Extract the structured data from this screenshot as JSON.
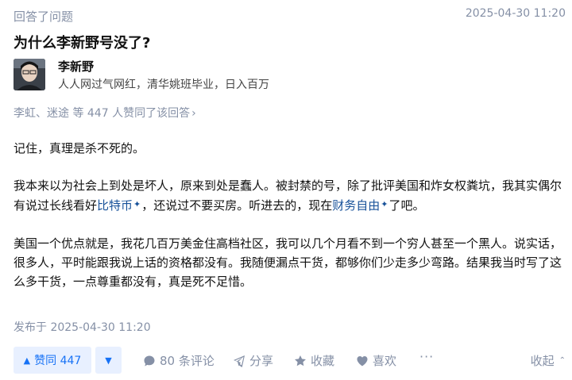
{
  "header": {
    "kicker": "回答了问题",
    "timestamp": "2025-04-30 11:20"
  },
  "question": {
    "title": "为什么李新野号没了?"
  },
  "author": {
    "name": "李新野",
    "bio": "人人网过气网红，清华姚班毕业，日入百万"
  },
  "voters": {
    "text": "李虹、迷途 等 447 人赞同了该回答",
    "chevron": "›"
  },
  "content": {
    "p1": "记住，真理是杀不死的。",
    "p2_a": "我本来以为社会上到处是坏人，原来到处是蠢人。被封禁的号，除了批评美国和炸女权粪坑，我其实偶尔有说过长线看好",
    "p2_link1": "比特币",
    "p2_b": "，还说过不要买房。听进去的，现在",
    "p2_link2": "财务自由",
    "p2_c": "了吧。",
    "p3": "美国一个优点就是，我花几百万美金住高档社区，我可以几个月看不到一个穷人甚至一个黑人。说实话，很多人，平时能跟我说上话的资格都没有。我随便漏点干货，都够你们少走多少弯路。结果我当时写了这么多干货，一点尊重都没有，真是死不足惜。",
    "spark_glyph": "✦"
  },
  "footer": {
    "published": "发布于 2025-04-30 11:20"
  },
  "actions": {
    "upvote": "赞同 447",
    "upvote_glyph": "▲",
    "downvote_glyph": "▼",
    "comment": "80 条评论",
    "share": "分享",
    "favorite": "收藏",
    "like": "喜欢",
    "more": "···",
    "collapse": "收起",
    "collapse_glyph": "⌃"
  },
  "colors": {
    "accent": "#1772f6",
    "accent_bg": "#e8f0ff",
    "muted": "#8590a6",
    "link": "#175199"
  },
  "icons": [
    "avatar",
    "comment-icon",
    "share-icon",
    "star-icon",
    "heart-icon",
    "more-icon"
  ]
}
